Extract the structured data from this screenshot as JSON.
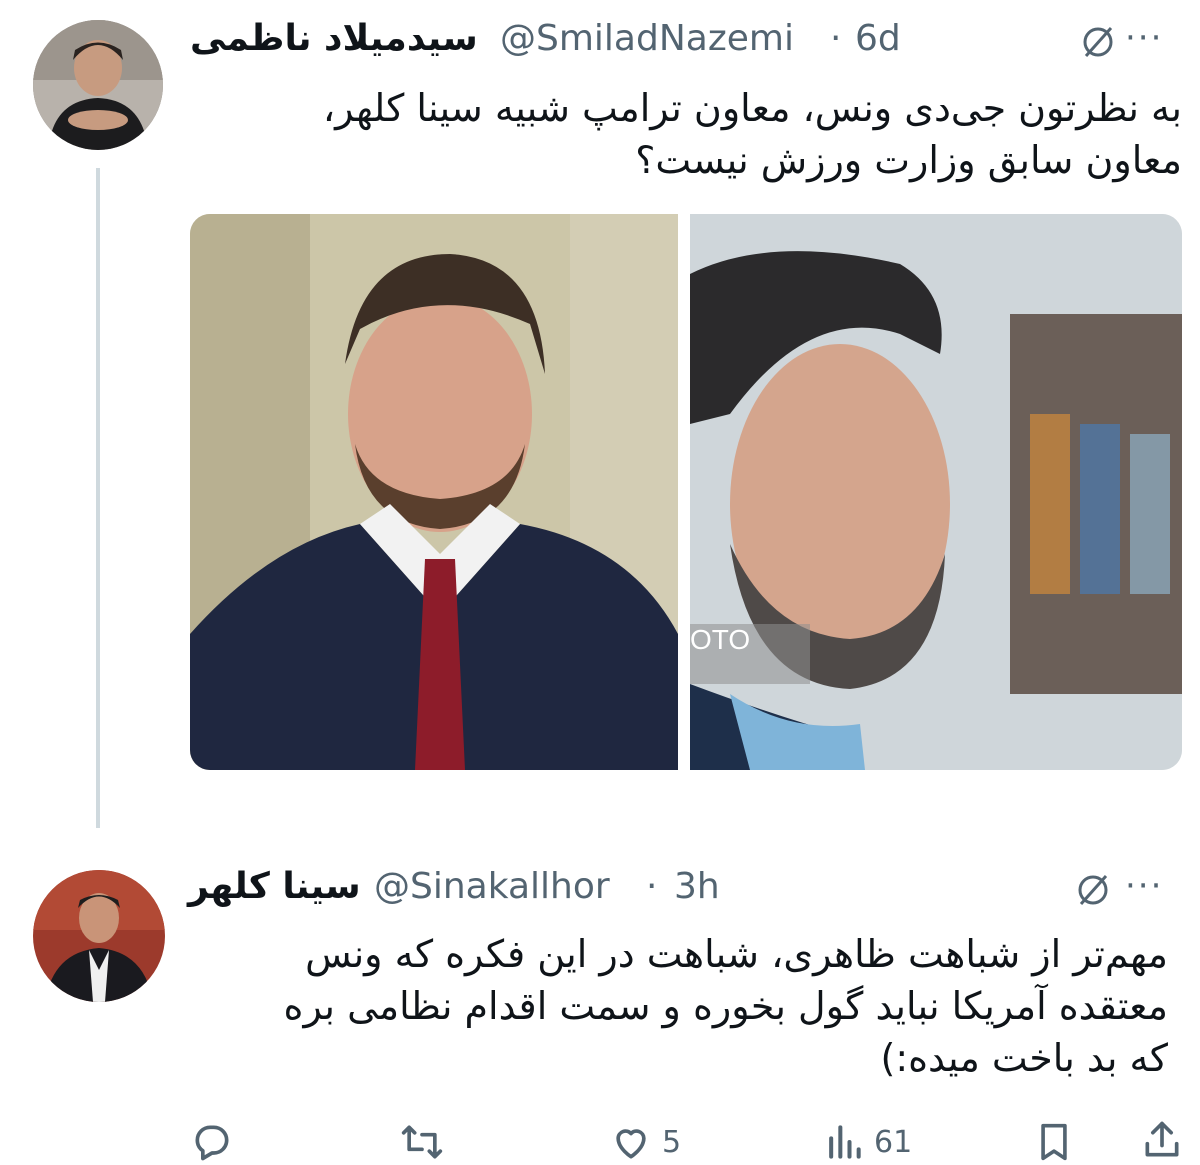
{
  "tweet1": {
    "display_name": "سیدمیلاد ناظمی",
    "handle": "@SmiladNazemi",
    "separator": "·",
    "time": "6d",
    "text": "به نظرتون جی‌دی ونس، معاون ترامپ شبیه سینا کلهر، معاون سابق وزارت ورزش نیست؟",
    "more": "···",
    "photo2_watermark": "OTO"
  },
  "tweet2": {
    "display_name": "سینا کلهر",
    "handle": "@Sinakallhor",
    "separator": "·",
    "time": "3h",
    "text": "مهم‌تر از شباهت ظاهری، شباهت در این فکره که ونس معتقده آمریکا نباید گول بخوره و سمت اقدام نظامی بره که بد باخت میده:)",
    "more": "···"
  },
  "actions": {
    "reply_count": "",
    "retweet_count": "",
    "like_count": "5",
    "views_count": "61"
  },
  "icons": [
    "grok-icon",
    "more-icon",
    "reply-icon",
    "retweet-icon",
    "like-icon",
    "views-icon",
    "bookmark-icon",
    "share-icon"
  ]
}
